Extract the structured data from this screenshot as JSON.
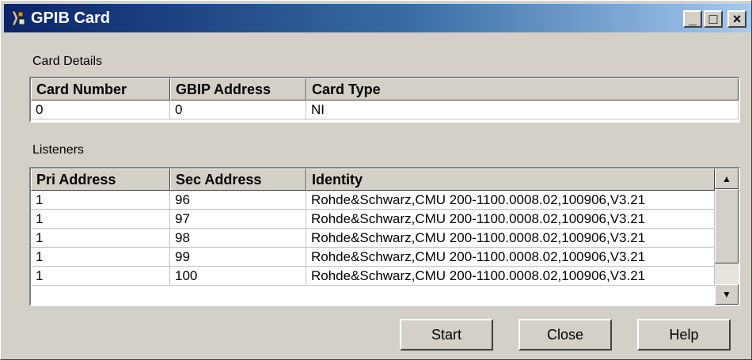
{
  "window": {
    "title": "GPIB Card",
    "icon": "gpib-card-app-icon"
  },
  "title_buttons": {
    "minimize": "_",
    "maximize": "□",
    "close": "×"
  },
  "card_details": {
    "label": "Card Details",
    "columns": [
      "Card Number",
      "GBIP Address",
      "Card Type"
    ],
    "rows": [
      [
        "0",
        "0",
        "NI"
      ]
    ]
  },
  "listeners": {
    "label": "Listeners",
    "columns": [
      "Pri Address",
      "Sec Address",
      "Identity"
    ],
    "rows": [
      [
        "1",
        "96",
        "Rohde&Schwarz,CMU 200-1100.0008.02,100906,V3.21"
      ],
      [
        "1",
        "97",
        "Rohde&Schwarz,CMU 200-1100.0008.02,100906,V3.21"
      ],
      [
        "1",
        "98",
        "Rohde&Schwarz,CMU 200-1100.0008.02,100906,V3.21"
      ],
      [
        "1",
        "99",
        "Rohde&Schwarz,CMU 200-1100.0008.02,100906,V3.21"
      ],
      [
        "1",
        "100",
        "Rohde&Schwarz,CMU 200-1100.0008.02,100906,V3.21"
      ]
    ]
  },
  "buttons": {
    "start": "Start",
    "close": "Close",
    "help": "Help"
  },
  "colors": {
    "titlebar_start": "#0a246a",
    "titlebar_end": "#a6caf0",
    "face": "#d4d0c8"
  }
}
